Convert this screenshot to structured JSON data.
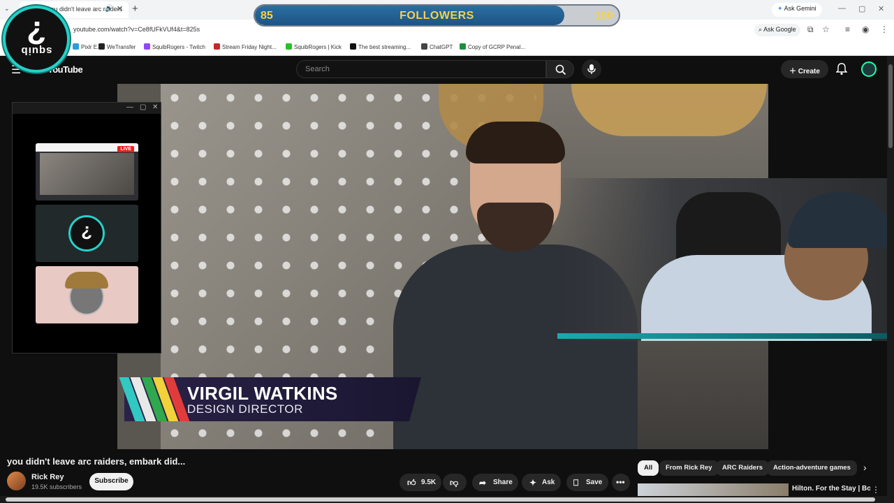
{
  "browser": {
    "tab": {
      "title": "you didn't leave arc raiders"
    },
    "url": "youtube.com/watch?v=Ce8fUFkVUf4&t=825s",
    "ask_gemini": "Ask Gemini",
    "ask_google": "Ask Google",
    "bookmarks": [
      {
        "label": "Pixlr E...",
        "color": "#2d9cdb"
      },
      {
        "label": "WeTransfer",
        "color": "#222222"
      },
      {
        "label": "SquibRogers - Twitch",
        "color": "#9146ff"
      },
      {
        "label": "Stream Friday Night...",
        "color": "#c62828"
      },
      {
        "label": "SquibRogers | Kick",
        "color": "#27c127"
      },
      {
        "label": "The best streaming...",
        "color": "#111111"
      },
      {
        "label": "ChatGPT",
        "color": "#444444"
      },
      {
        "label": "Copy of GCRP Penal...",
        "color": "#1e8e3e"
      }
    ]
  },
  "overlay": {
    "followers": {
      "current": "85",
      "label": "FOLLOWERS",
      "goal": "100",
      "progress": 0.85
    },
    "logo_text": "squib"
  },
  "youtube": {
    "search_placeholder": "Search",
    "create_label": "Create",
    "video": {
      "lower_third_name": "VIRGIL WATKINS",
      "lower_third_role": "DESIGN DIRECTOR"
    },
    "preview_window": {
      "live_badge": "LIVE"
    },
    "title": "you didn't leave arc raiders, embark did...",
    "channel": {
      "name": "Rick Rey",
      "subscribers": "19.5K subscribers"
    },
    "subscribe_label": "Subscribe",
    "actions": {
      "likes": "9.5K",
      "share": "Share",
      "ask": "Ask",
      "save": "Save"
    },
    "chips": [
      "All",
      "From Rick Rey",
      "ARC Raiders",
      "Action-adventure games"
    ],
    "recommendation": {
      "title": "Hilton. For the Stay | Book"
    }
  }
}
